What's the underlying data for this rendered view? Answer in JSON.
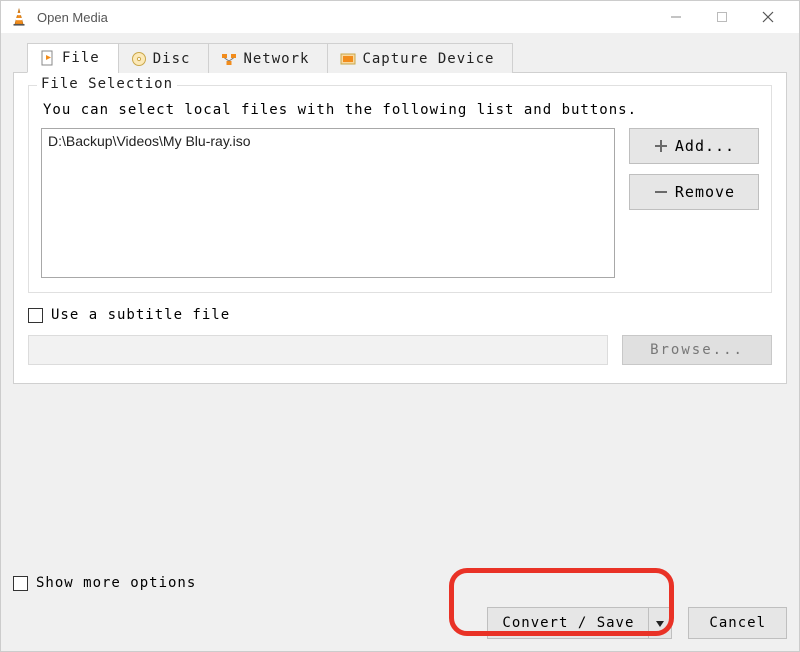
{
  "window": {
    "title": "Open Media"
  },
  "tabs": {
    "file": "File",
    "disc": "Disc",
    "network": "Network",
    "capture": "Capture Device"
  },
  "file_section": {
    "legend": "File Selection",
    "hint": "You can select local files with the following list and buttons.",
    "selected_file": "D:\\Backup\\Videos\\My Blu-ray.iso",
    "add_label": "Add...",
    "remove_label": "Remove",
    "subtitle_checkbox": "Use a subtitle file",
    "subtitle_checked": false,
    "browse_label": "Browse..."
  },
  "bottom": {
    "more_options": "Show more options",
    "more_checked": false,
    "convert_label": "Convert / Save",
    "cancel_label": "Cancel"
  }
}
